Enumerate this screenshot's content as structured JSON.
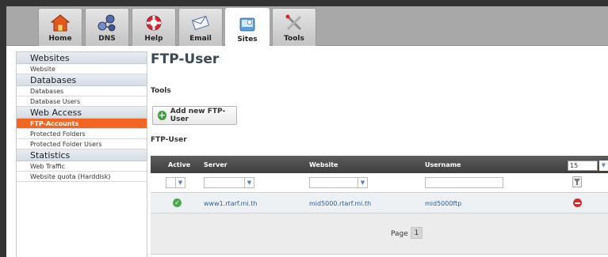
{
  "nav": {
    "tabs": [
      {
        "label": "Home",
        "icon": "home-icon"
      },
      {
        "label": "DNS",
        "icon": "dns-icon"
      },
      {
        "label": "Help",
        "icon": "help-icon"
      },
      {
        "label": "Email",
        "icon": "email-icon"
      },
      {
        "label": "Sites",
        "icon": "sites-icon",
        "active": true
      },
      {
        "label": "Tools",
        "icon": "tools-icon"
      }
    ]
  },
  "sidebar": {
    "sections": [
      {
        "title": "Websites",
        "items": [
          "Website"
        ]
      },
      {
        "title": "Databases",
        "items": [
          "Databases",
          "Database Users"
        ]
      },
      {
        "title": "Web Access",
        "items": [
          "FTP-Accounts",
          "Protected Folders",
          "Protected Folder Users"
        ]
      },
      {
        "title": "Statistics",
        "items": [
          "Web Traffic",
          "Website quota (Harddisk)"
        ]
      }
    ],
    "active_item": "FTP-Accounts"
  },
  "main": {
    "title": "FTP-User",
    "tools_label": "Tools",
    "add_button_label": "Add new FTP-User",
    "list_label": "FTP-User",
    "table": {
      "columns": [
        "Active",
        "Server",
        "Website",
        "Username"
      ],
      "page_size": "15",
      "rows": [
        {
          "active": true,
          "server": "www1.rtarf.mi.th",
          "website": "mid5000.rtarf.mi.th",
          "username": "mid5000ftp"
        }
      ]
    },
    "pager": {
      "label": "Page",
      "current": "1"
    }
  },
  "colors": {
    "accent": "#f26522",
    "frame": "#333333",
    "tabbar": "#a8a8a8",
    "link": "#2e5f8f",
    "success": "#4ca84c",
    "danger": "#d9272e"
  }
}
